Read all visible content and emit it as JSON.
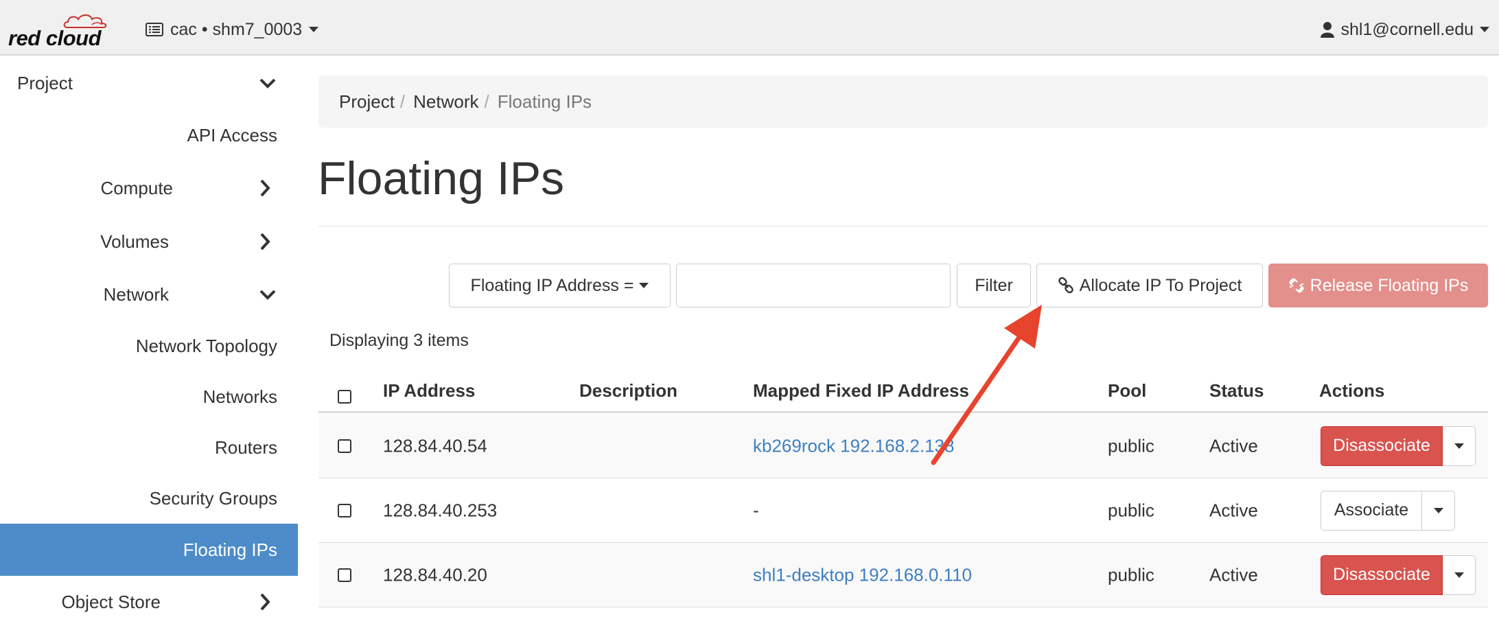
{
  "header": {
    "logo_text": "red cloud",
    "project_label": "cac • shm7_0003",
    "user_label": "shl1@cornell.edu"
  },
  "sidebar": {
    "items": [
      {
        "label": "Project",
        "icon": "chevron-down-icon"
      },
      {
        "label": "API Access",
        "icon": ""
      },
      {
        "label": "Compute",
        "icon": "chevron-right-icon"
      },
      {
        "label": "Volumes",
        "icon": "chevron-right-icon"
      },
      {
        "label": "Network",
        "icon": "chevron-down-icon"
      },
      {
        "label": "Network Topology",
        "icon": ""
      },
      {
        "label": "Networks",
        "icon": ""
      },
      {
        "label": "Routers",
        "icon": ""
      },
      {
        "label": "Security Groups",
        "icon": ""
      },
      {
        "label": "Floating IPs",
        "icon": "",
        "active": true
      },
      {
        "label": "Object Store",
        "icon": "chevron-right-icon"
      }
    ]
  },
  "breadcrumb": {
    "items": [
      "Project",
      "Network",
      "Floating IPs"
    ],
    "separator": "/"
  },
  "page": {
    "title": "Floating IPs"
  },
  "toolbar": {
    "filter_select": "Floating IP Address =",
    "filter_input_value": "",
    "filter_button": "Filter",
    "allocate_button": "Allocate IP To Project",
    "release_button": "Release Floating IPs"
  },
  "table": {
    "count_label": "Displaying 3 items",
    "columns": [
      "IP Address",
      "Description",
      "Mapped Fixed IP Address",
      "Pool",
      "Status",
      "Actions"
    ],
    "rows": [
      {
        "ip": "128.84.40.54",
        "description": "",
        "mapped": "kb269rock 192.168.2.138",
        "pool": "public",
        "status": "Active",
        "action": "Disassociate"
      },
      {
        "ip": "128.84.40.253",
        "description": "",
        "mapped": "-",
        "pool": "public",
        "status": "Active",
        "action": "Associate"
      },
      {
        "ip": "128.84.40.20",
        "description": "",
        "mapped": "shl1-desktop 192.168.0.110",
        "pool": "public",
        "status": "Active",
        "action": "Disassociate"
      }
    ]
  },
  "colors": {
    "active_nav": "#4d8cc8",
    "danger": "#d9534f",
    "release_disabled": "#e38f8b",
    "link": "#3f7fc0",
    "annotation_arrow": "#e8432d"
  }
}
